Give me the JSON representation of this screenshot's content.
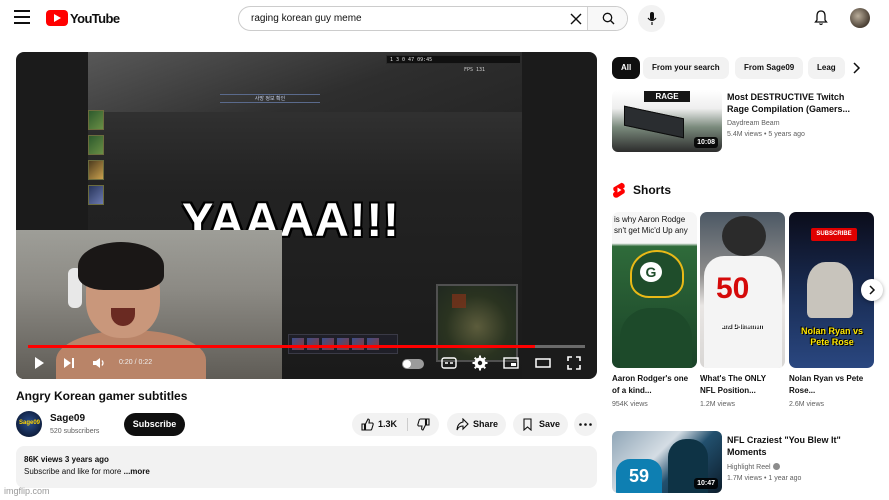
{
  "app": {
    "logo_text": "YouTube"
  },
  "search": {
    "query": "raging korean guy meme",
    "placeholder": "Search"
  },
  "player": {
    "hud_stats": "1 3 0 47 09:45",
    "fps_text": "FPS 131",
    "kr_banner": "사망 정보 확인",
    "caption": "YAAAA!!!",
    "time": "0:20 / 0:22",
    "progress_fraction": 0.91
  },
  "video": {
    "title": "Angry Korean gamer subtitles",
    "channel_avatar_text": "Sage09",
    "channel_name": "Sage09",
    "subscribers": "520 subscribers",
    "subscribe_label": "Subscribe",
    "likes": "1.3K",
    "share_label": "Share",
    "save_label": "Save",
    "description_meta": "86K views  3 years ago",
    "description_text": "Subscribe and like for more",
    "description_more": "...more"
  },
  "watermark": "imgflip.com",
  "chips": [
    "All",
    "From your search",
    "From Sage09",
    "Leag"
  ],
  "recommended": [
    {
      "thumb_label": "RAGE",
      "duration": "10:08",
      "title": "Most DESTRUCTIVE Twitch Rage Compilation (Gamers...",
      "channel": "Daydream Beam",
      "meta": "5.4M views • 5 years ago"
    },
    {
      "duration": "10:47",
      "jersey_number": "59",
      "title": "NFL Craziest \"You Blew It\" Moments",
      "channel": "Highlight Reel",
      "meta": "1.7M views • 1 year ago"
    }
  ],
  "shorts": {
    "heading": "Shorts",
    "items": [
      {
        "overlay_text": "is why Aaron Rodge\nsn't get Mic'd Up any",
        "title": "Aaron Rodger's one of a kind...",
        "views": "954K views"
      },
      {
        "overlay_text": "and D-linemen",
        "jersey_number": "50",
        "title": "What's The ONLY NFL Position...",
        "views": "1.2M views"
      },
      {
        "overlay_text": "Nolan Ryan vs Pete Rose",
        "sticker_text": "SUBSCRIBE",
        "title": "Nolan Ryan vs Pete Rose...",
        "views": "2.6M views"
      }
    ]
  },
  "colors": {
    "accent": "#ff0000",
    "text": "#0f0f0f",
    "secondary_text": "#606060",
    "chip_bg": "#f2f2f2"
  },
  "icons": [
    "menu-icon",
    "youtube-logo-icon",
    "clear-icon",
    "search-icon",
    "mic-icon",
    "bell-icon",
    "play-icon",
    "next-icon",
    "volume-icon",
    "captions-icon",
    "settings-icon",
    "miniplayer-icon",
    "theater-icon",
    "fullscreen-icon",
    "thumbs-up-icon",
    "thumbs-down-icon",
    "share-icon",
    "save-icon",
    "more-icon",
    "chevron-right-icon",
    "shorts-icon",
    "verified-icon"
  ]
}
